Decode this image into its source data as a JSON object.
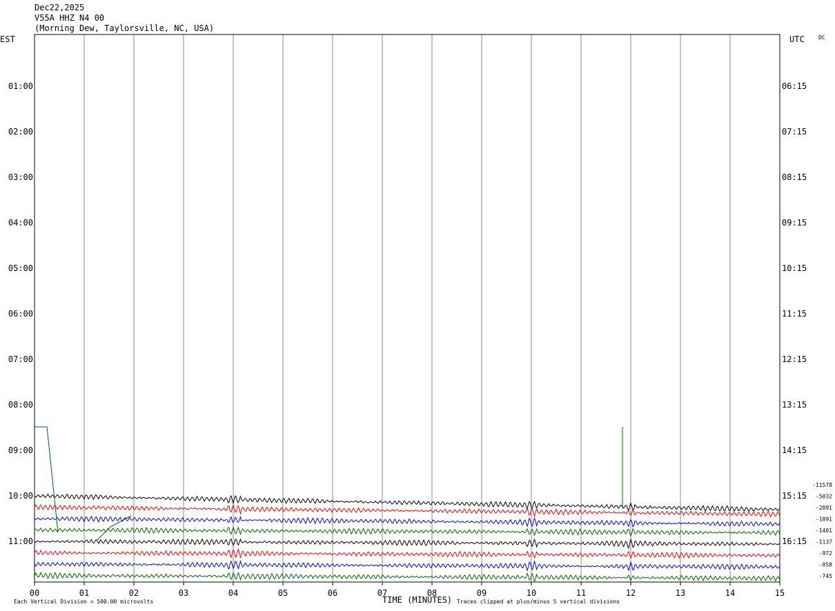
{
  "header": {
    "date": "Dec22,2025",
    "station": "V55A HHZ N4 00",
    "location": "(Morning Dew, Taylorsville, NC, USA)"
  },
  "left_tz": "EST",
  "right_tz": "UTC",
  "corner_tag": "DC",
  "footer": {
    "division_note": "Each Vertical Division =  500.00 microvolts",
    "xlabel": "TIME (MINUTES)",
    "clip_note": "Traces clipped at plus/minus 5 vertical divisions"
  },
  "chart_data": {
    "type": "line",
    "title": "V55A HHZ N4 00",
    "xlabel": "TIME (MINUTES)",
    "xlim": [
      0,
      15
    ],
    "x_ticks": [
      "00",
      "01",
      "02",
      "03",
      "04",
      "05",
      "06",
      "07",
      "08",
      "09",
      "10",
      "11",
      "12",
      "13",
      "14",
      "15"
    ],
    "left_hour_labels": [
      "01:00",
      "02:00",
      "03:00",
      "04:00",
      "05:00",
      "06:00",
      "07:00",
      "08:00",
      "09:00",
      "10:00",
      "11:00"
    ],
    "right_hour_labels": [
      "06:15",
      "07:15",
      "08:15",
      "09:15",
      "10:15",
      "11:15",
      "12:15",
      "13:15",
      "14:15",
      "15:15",
      "16:15"
    ],
    "row_offsets": [
      "-11578",
      "-5032",
      "-2891",
      "-1891",
      "-1401",
      "-1137",
      "-972",
      "-858",
      "-745"
    ],
    "trace_colors": [
      "#000000",
      "#ff0000",
      "#0000ff",
      "#006600"
    ],
    "grid": true,
    "clip_divisions": 5
  }
}
